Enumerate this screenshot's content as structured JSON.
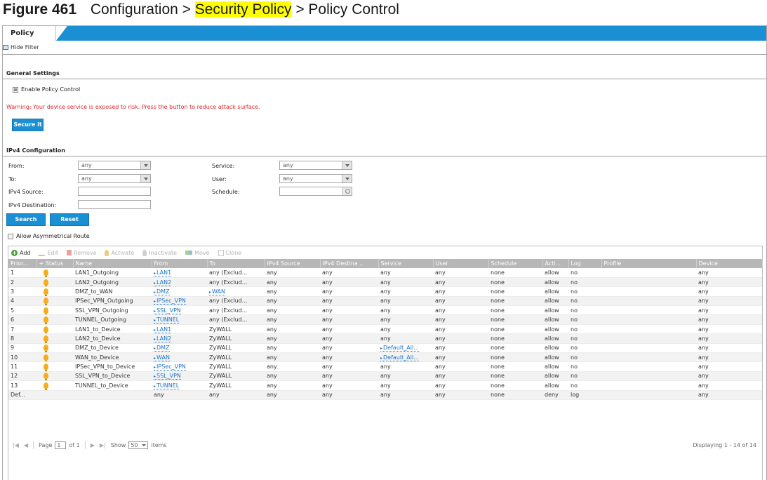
{
  "caption": {
    "figure_number": "Figure 461",
    "path_prefix": "Configuration >",
    "path_highlight": "Security Policy",
    "path_suffix": "> Policy Control"
  },
  "tabs": [
    {
      "label": "Policy"
    }
  ],
  "hide_filter_label": "Hide Filter",
  "general": {
    "title": "General Settings",
    "enable_label": "Enable Policy Control",
    "enable_checked": true,
    "warning": "Warning: Your device service is exposed to risk. Press the button to reduce attack surface.",
    "secure_button": "Secure it"
  },
  "ipv4": {
    "title": "IPv4 Configuration",
    "from_label": "From:",
    "from_value": "any",
    "to_label": "To:",
    "to_value": "any",
    "source_label": "IPv4 Source:",
    "source_value": "",
    "destination_label": "IPv4 Destination:",
    "destination_value": "",
    "service_label": "Service:",
    "service_value": "any",
    "user_label": "User:",
    "user_value": "any",
    "schedule_label": "Schedule:",
    "schedule_value": "",
    "search_button": "Search",
    "reset_button": "Reset",
    "asym_label": "Allow Asymmetrical Route",
    "asym_checked": false
  },
  "toolbar": {
    "add": "Add",
    "edit": "Edit",
    "remove": "Remove",
    "activate": "Activate",
    "inactivate": "Inactivate",
    "move": "Move",
    "clone": "Clone"
  },
  "columns": [
    "Prior...",
    "+ Status",
    "Name",
    "From",
    "To",
    "IPv4 Source",
    "IPv4 Destina...",
    "Service",
    "User",
    "Schedule",
    "Acti...",
    "Log",
    "Profile",
    "Device"
  ],
  "rows": [
    {
      "priority": "1",
      "status": "active",
      "name": "LAN1_Outgoing",
      "from": "LAN1",
      "from_obj": true,
      "to": "any (Exclud...",
      "to_obj": false,
      "src": "any",
      "dst": "any",
      "service": "any",
      "service_obj": false,
      "user": "any",
      "schedule": "none",
      "action": "allow",
      "log": "no",
      "profile": "",
      "device": "any"
    },
    {
      "priority": "2",
      "status": "active",
      "name": "LAN2_Outgoing",
      "from": "LAN2",
      "from_obj": true,
      "to": "any (Exclud...",
      "to_obj": false,
      "src": "any",
      "dst": "any",
      "service": "any",
      "service_obj": false,
      "user": "any",
      "schedule": "none",
      "action": "allow",
      "log": "no",
      "profile": "",
      "device": "any"
    },
    {
      "priority": "3",
      "status": "active",
      "name": "DMZ_to_WAN",
      "from": "DMZ",
      "from_obj": true,
      "to": "WAN",
      "to_obj": true,
      "src": "any",
      "dst": "any",
      "service": "any",
      "service_obj": false,
      "user": "any",
      "schedule": "none",
      "action": "allow",
      "log": "no",
      "profile": "",
      "device": "any"
    },
    {
      "priority": "4",
      "status": "active",
      "name": "IPSec_VPN_Outgoing",
      "from": "IPSec_VPN",
      "from_obj": true,
      "to": "any (Exclud...",
      "to_obj": false,
      "src": "any",
      "dst": "any",
      "service": "any",
      "service_obj": false,
      "user": "any",
      "schedule": "none",
      "action": "allow",
      "log": "no",
      "profile": "",
      "device": "any"
    },
    {
      "priority": "5",
      "status": "active",
      "name": "SSL_VPN_Outgoing",
      "from": "SSL_VPN",
      "from_obj": true,
      "to": "any (Exclud...",
      "to_obj": false,
      "src": "any",
      "dst": "any",
      "service": "any",
      "service_obj": false,
      "user": "any",
      "schedule": "none",
      "action": "allow",
      "log": "no",
      "profile": "",
      "device": "any"
    },
    {
      "priority": "6",
      "status": "active",
      "name": "TUNNEL_Outgoing",
      "from": "TUNNEL",
      "from_obj": true,
      "to": "any (Exclud...",
      "to_obj": false,
      "src": "any",
      "dst": "any",
      "service": "any",
      "service_obj": false,
      "user": "any",
      "schedule": "none",
      "action": "allow",
      "log": "no",
      "profile": "",
      "device": "any"
    },
    {
      "priority": "7",
      "status": "active",
      "name": "LAN1_to_Device",
      "from": "LAN1",
      "from_obj": true,
      "to": "ZyWALL",
      "to_obj": false,
      "src": "any",
      "dst": "any",
      "service": "any",
      "service_obj": false,
      "user": "any",
      "schedule": "none",
      "action": "allow",
      "log": "no",
      "profile": "",
      "device": "any"
    },
    {
      "priority": "8",
      "status": "active",
      "name": "LAN2_to_Device",
      "from": "LAN2",
      "from_obj": true,
      "to": "ZyWALL",
      "to_obj": false,
      "src": "any",
      "dst": "any",
      "service": "any",
      "service_obj": false,
      "user": "any",
      "schedule": "none",
      "action": "allow",
      "log": "no",
      "profile": "",
      "device": "any"
    },
    {
      "priority": "9",
      "status": "active",
      "name": "DMZ_to_Device",
      "from": "DMZ",
      "from_obj": true,
      "to": "ZyWALL",
      "to_obj": false,
      "src": "any",
      "dst": "any",
      "service": "Default_All...",
      "service_obj": true,
      "user": "any",
      "schedule": "none",
      "action": "allow",
      "log": "no",
      "profile": "",
      "device": "any"
    },
    {
      "priority": "10",
      "status": "active",
      "name": "WAN_to_Device",
      "from": "WAN",
      "from_obj": true,
      "to": "ZyWALL",
      "to_obj": false,
      "src": "any",
      "dst": "any",
      "service": "Default_All...",
      "service_obj": true,
      "user": "any",
      "schedule": "none",
      "action": "allow",
      "log": "no",
      "profile": "",
      "device": "any"
    },
    {
      "priority": "11",
      "status": "active",
      "name": "IPSec_VPN_to_Device",
      "from": "IPSec_VPN",
      "from_obj": true,
      "to": "ZyWALL",
      "to_obj": false,
      "src": "any",
      "dst": "any",
      "service": "any",
      "service_obj": false,
      "user": "any",
      "schedule": "none",
      "action": "allow",
      "log": "no",
      "profile": "",
      "device": "any"
    },
    {
      "priority": "12",
      "status": "active",
      "name": "SSL_VPN_to_Device",
      "from": "SSL_VPN",
      "from_obj": true,
      "to": "ZyWALL",
      "to_obj": false,
      "src": "any",
      "dst": "any",
      "service": "any",
      "service_obj": false,
      "user": "any",
      "schedule": "none",
      "action": "allow",
      "log": "no",
      "profile": "",
      "device": "any"
    },
    {
      "priority": "13",
      "status": "active",
      "name": "TUNNEL_to_Device",
      "from": "TUNNEL",
      "from_obj": true,
      "to": "ZyWALL",
      "to_obj": false,
      "src": "any",
      "dst": "any",
      "service": "any",
      "service_obj": false,
      "user": "any",
      "schedule": "none",
      "action": "allow",
      "log": "no",
      "profile": "",
      "device": "any"
    },
    {
      "priority": "Def...",
      "status": "",
      "name": "",
      "from": "any",
      "from_obj": false,
      "to": "any",
      "to_obj": false,
      "src": "any",
      "dst": "any",
      "service": "any",
      "service_obj": false,
      "user": "any",
      "schedule": "none",
      "action": "deny",
      "log": "log",
      "profile": "",
      "device": "any"
    }
  ],
  "pager": {
    "page_label": "Page",
    "page_value": "1",
    "of_label": "of 1",
    "show_label": "Show",
    "show_value": "50",
    "items_label": "items",
    "displaying": "Displaying 1 - 14 of 14"
  },
  "colors": {
    "accent": "#1b8fd3",
    "warning": "#e2232a",
    "header_gray": "#b7b7b7",
    "status_active": "#f5ad1b",
    "highlight": "#ffff00"
  }
}
